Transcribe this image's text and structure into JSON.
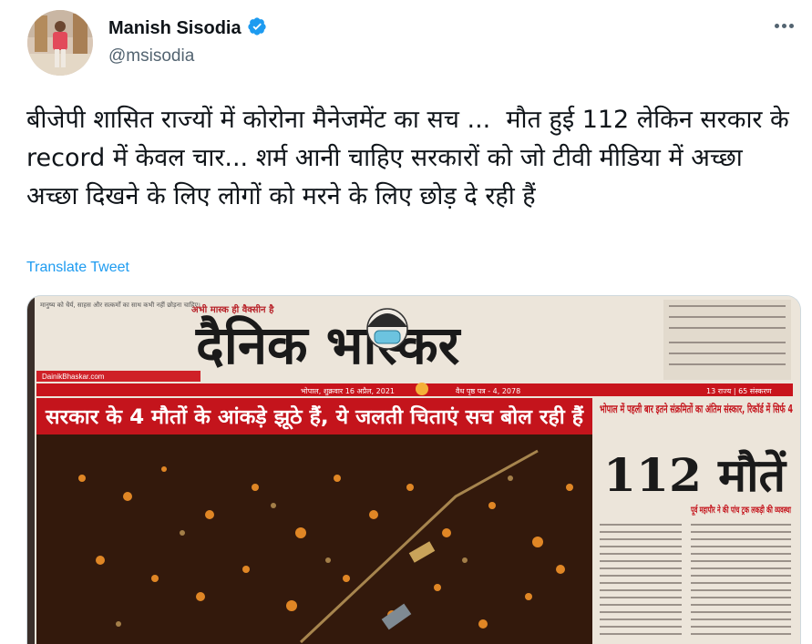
{
  "author": {
    "name": "Manish Sisodia",
    "handle": "@msisodia",
    "verified_icon": "verified-badge-icon",
    "avatar_icon": "profile-photo"
  },
  "more_icon": "more-dots-icon",
  "tweet": {
    "text": "बीजेपी शासित राज्यों में कोरोना मैनेजमेंट का सच ...  मौत हुई 112 लेकिन सरकार के record में केवल चार... शर्म आनी चाहिए सरकारों को जो टीवी मीडिया में अच्छा अच्छा दिखने के लिए लोगों को मरने के लिए छोड़ दे रही हैं",
    "translate_label": "Translate Tweet"
  },
  "newspaper": {
    "masthead": "दैनिक भास्कर",
    "top_line": "अभी मास्क ही वैक्सीन है",
    "top_left_note": "मानुष्य को धैर्य, साहस और सत्कर्मों का साथ कभी नहीं छोड़ना चाहिए।",
    "website": "DainikBhaskar.com",
    "dateline": "भोपाल, शुक्रवार 16 अप्रैल, 2021",
    "edition": "वैध पृष्ठ पत्र - 4, 2078",
    "headline": "सरकार के 4 मौतों के आंकड़े झूठे हैं, ये जलती चिताएं सच बोल रही हैं",
    "side_kicker": "भोपाल में पहली बार इतने संक्रमितों का अंतिम संस्कार, रिकॉर्ड में सिर्फ 4",
    "big_number": "112 मौतें",
    "sub_story": "पूर्व महापौर ने की पांच ट्रक लकड़ी की व्यवस्था",
    "pages_info": "13 राज्य | 65 संस्करण"
  },
  "colors": {
    "link": "#1d9bf0",
    "verified": "#1d9bf0",
    "headline_red": "#c4141c",
    "masthead": "#1a1a1a"
  }
}
